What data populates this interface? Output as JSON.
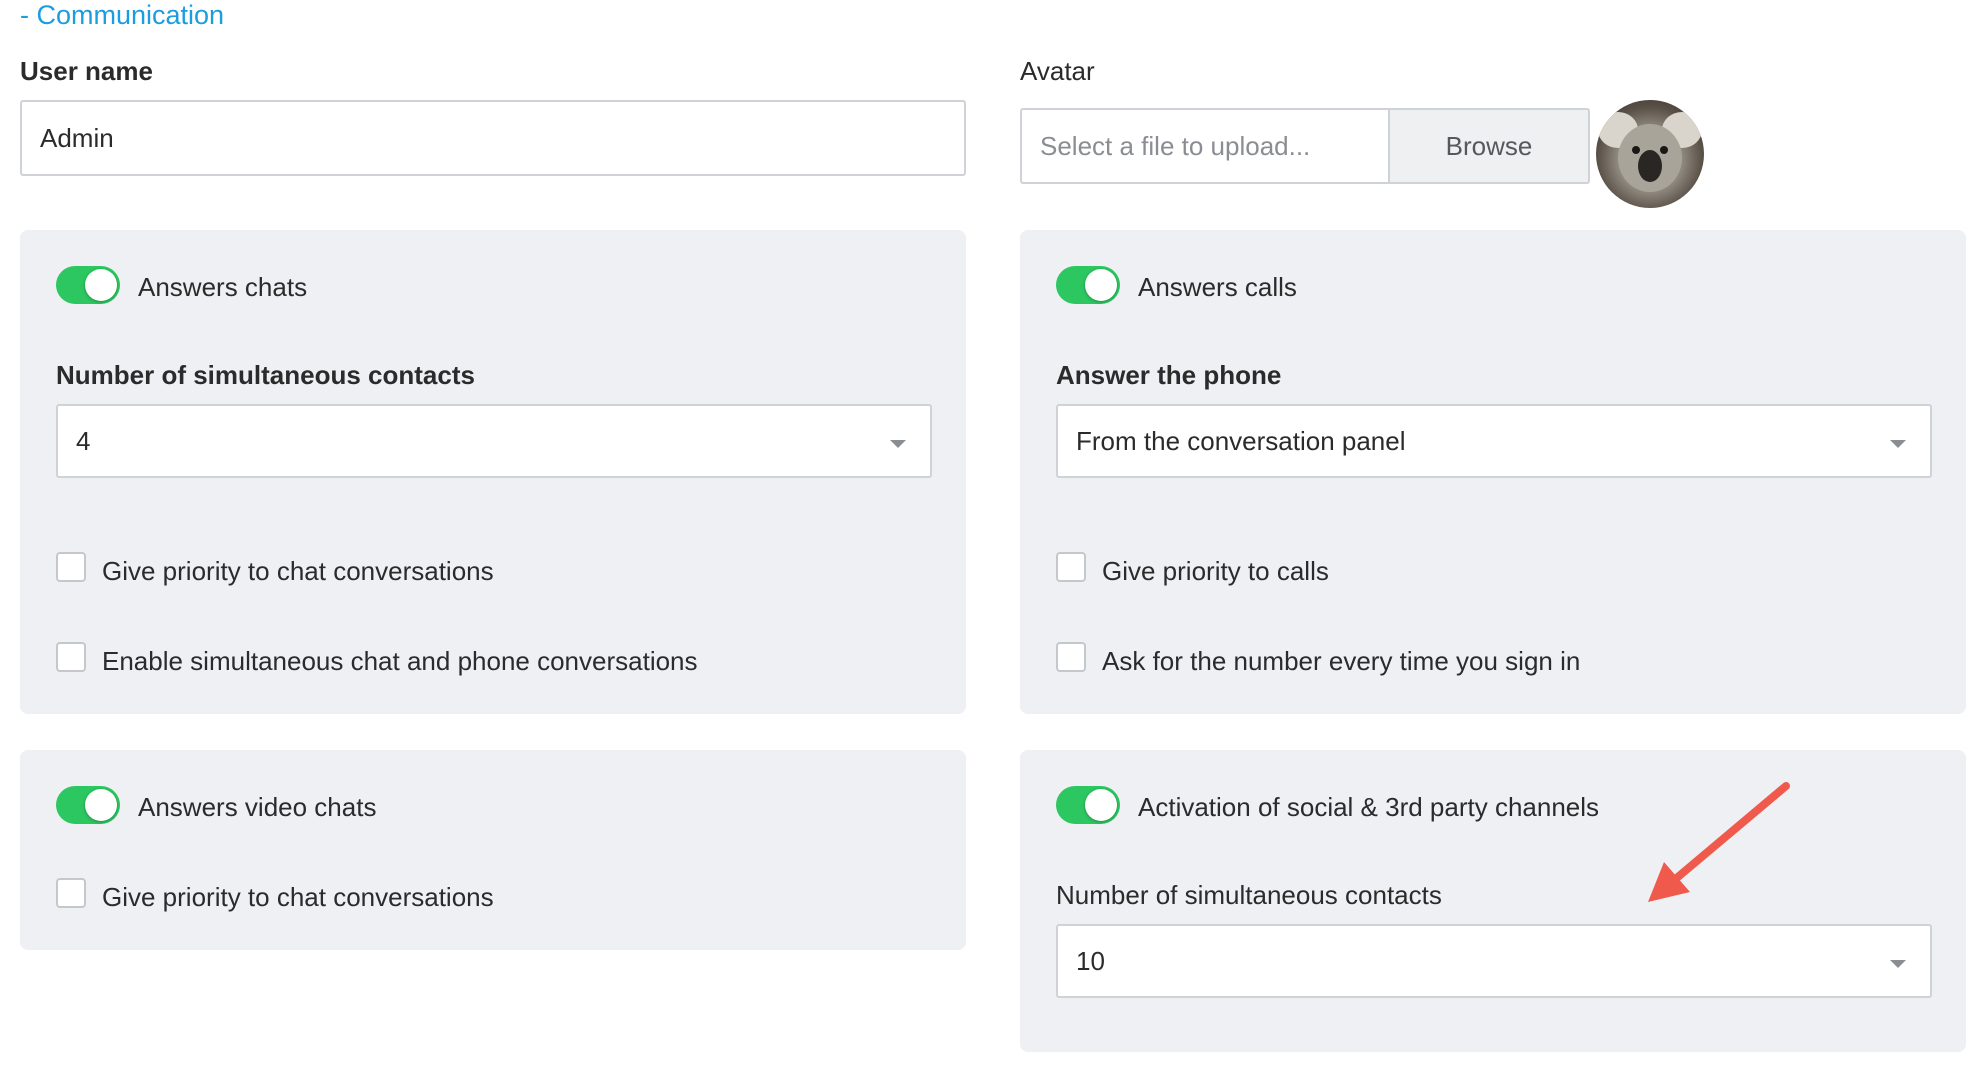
{
  "section": {
    "title": "- Communication"
  },
  "user": {
    "label": "User name",
    "value": "Admin"
  },
  "avatar": {
    "label": "Avatar",
    "placeholder": "Select a file to upload...",
    "browse_label": "Browse",
    "image_icon": "koala-avatar"
  },
  "chats_panel": {
    "toggle_label": "Answers chats",
    "toggle_on": true,
    "contacts_label": "Number of simultaneous contacts",
    "contacts_value": "4",
    "priority_label": "Give priority to chat conversations",
    "simultaneous_label": "Enable simultaneous chat and phone conversations"
  },
  "calls_panel": {
    "toggle_label": "Answers calls",
    "toggle_on": true,
    "answer_label": "Answer the phone",
    "answer_value": "From the conversation panel",
    "priority_label": "Give priority to calls",
    "ask_number_label": "Ask for the number every time you sign in"
  },
  "video_panel": {
    "toggle_label": "Answers video chats",
    "toggle_on": true,
    "priority_label": "Give priority to chat conversations"
  },
  "social_panel": {
    "toggle_label": "Activation of social & 3rd party channels",
    "toggle_on": true,
    "contacts_label": "Number of simultaneous contacts",
    "contacts_value": "10"
  },
  "colors": {
    "accent": "#1a9ee0",
    "toggle_on": "#2cc760",
    "panel_bg": "#eff0f4",
    "annotation_arrow": "#ef5a4c"
  }
}
